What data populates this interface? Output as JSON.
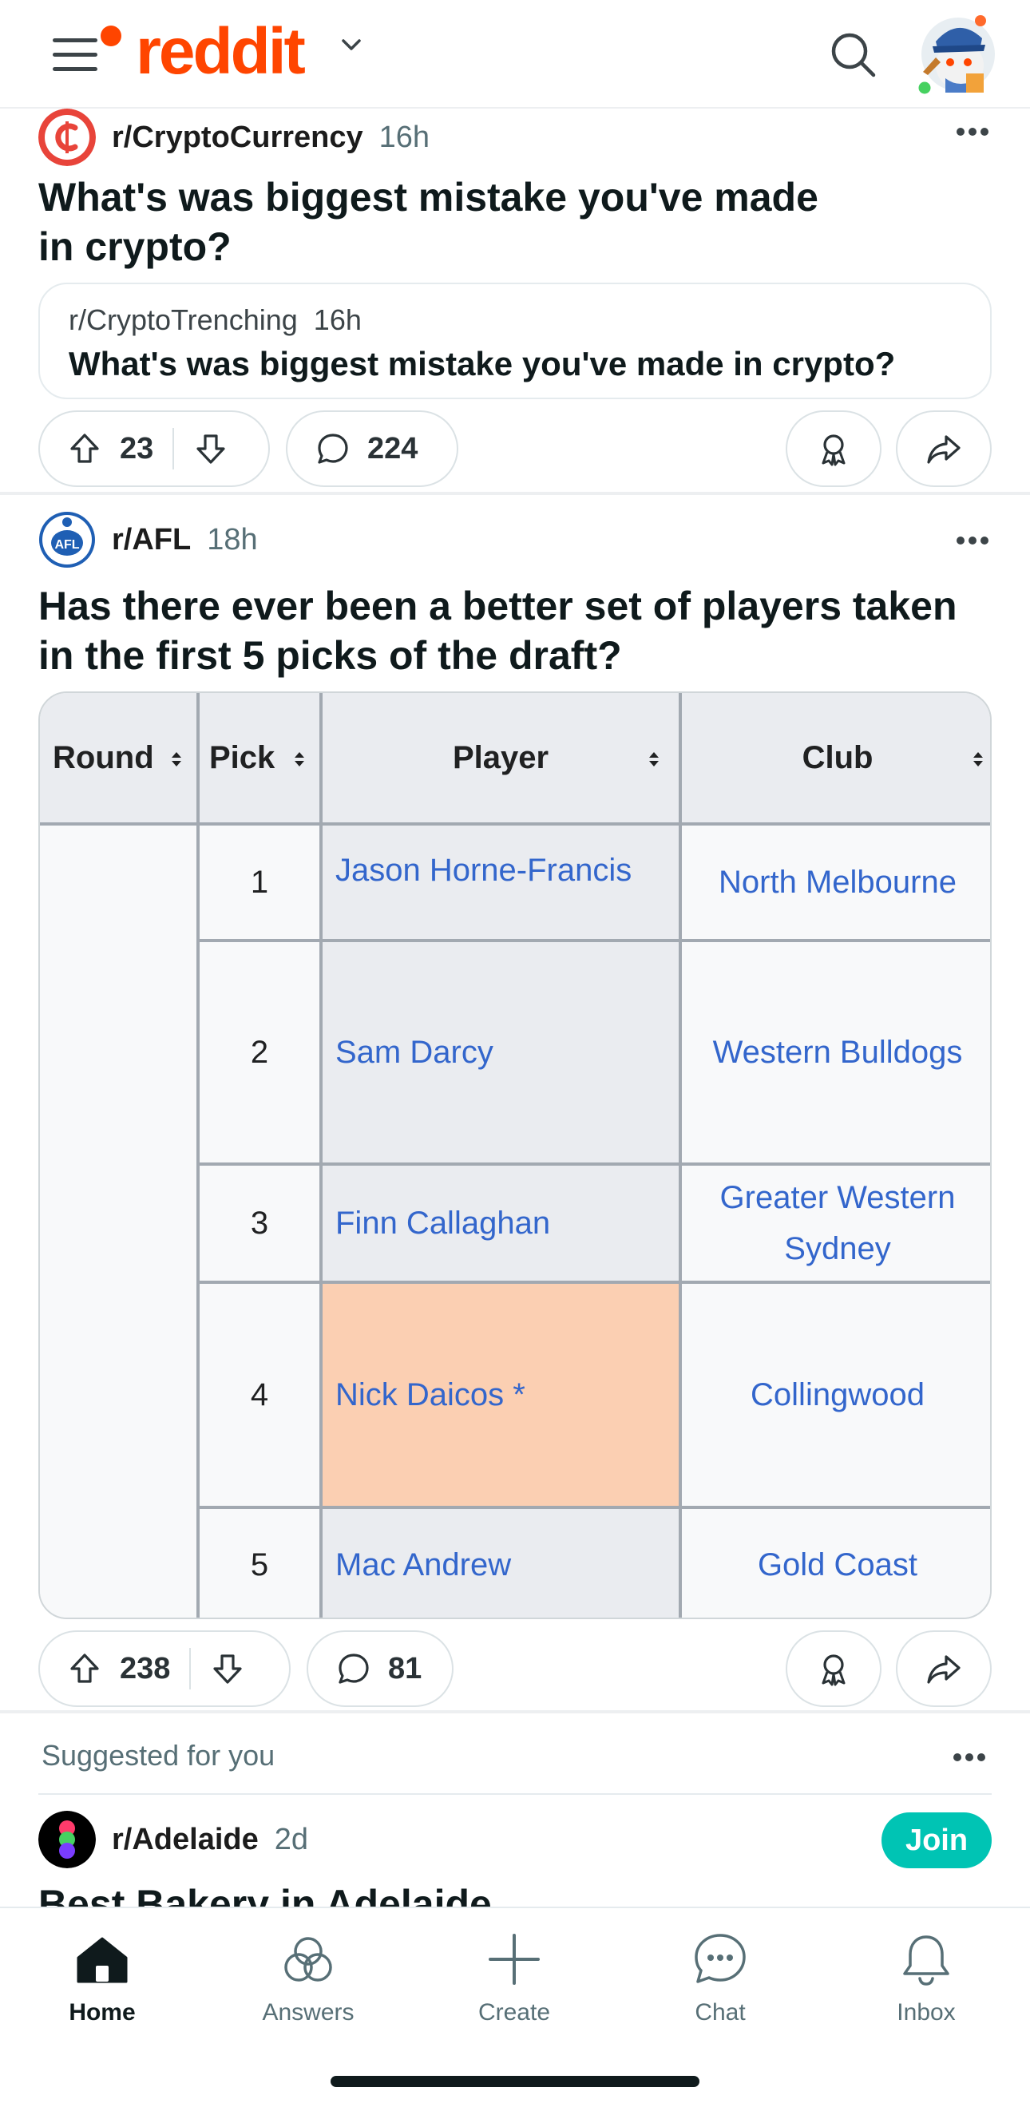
{
  "header": {
    "logo_text": "reddit",
    "brand_color": "#ff4500",
    "icons": [
      "menu-icon",
      "chevron-down-icon",
      "search-icon",
      "avatar"
    ]
  },
  "posts": [
    {
      "subreddit": "r/CryptoCurrency",
      "time": "16h",
      "title_line1": "What's was biggest mistake you've made",
      "title_line2": "in crypto?",
      "crosspost": {
        "subreddit": "r/CryptoTrenching",
        "time": "16h",
        "title": "What's was biggest mistake you've made in crypto?"
      },
      "upvotes": "23",
      "comments": "224"
    },
    {
      "subreddit": "r/AFL",
      "time": "18h",
      "title_line1": "Has there ever been a better set of players taken",
      "title_line2": "in the first 5 picks of the draft?",
      "table": {
        "headers": [
          "Round",
          "Pick",
          "Player",
          "Club"
        ],
        "rows": [
          {
            "pick": "1",
            "player": "Jason Horne-Francis",
            "club": "North Melbourne"
          },
          {
            "pick": "2",
            "player": "Sam Darcy",
            "club": "Western Bulldogs"
          },
          {
            "pick": "3",
            "player": "Finn Callaghan",
            "club_line1": "Greater Western",
            "club_line2": "Sydney"
          },
          {
            "pick": "4",
            "player": "Nick Daicos *",
            "club": "Collingwood"
          },
          {
            "pick": "5",
            "player": "Mac Andrew",
            "club": "Gold Coast"
          }
        ],
        "highlight_color": "#fbcfb2",
        "link_color": "#3366cc"
      },
      "upvotes": "238",
      "comments": "81"
    }
  ],
  "suggested": {
    "label": "Suggested for you",
    "subreddit": "r/Adelaide",
    "time": "2d",
    "join_label": "Join",
    "join_color": "#00c4b4",
    "peek_title": "Best Bakery in Adelaide"
  },
  "bottom_nav": {
    "items": [
      {
        "label": "Home",
        "icon": "home-icon",
        "active": true
      },
      {
        "label": "Answers",
        "icon": "answers-icon"
      },
      {
        "label": "Create",
        "icon": "plus-icon"
      },
      {
        "label": "Chat",
        "icon": "chat-icon"
      },
      {
        "label": "Inbox",
        "icon": "bell-icon"
      }
    ]
  }
}
